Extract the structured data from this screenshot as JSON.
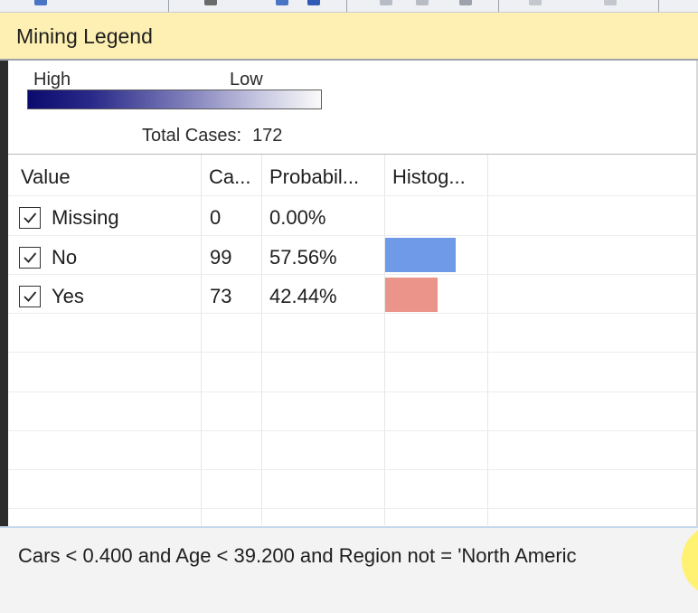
{
  "window": {
    "title": "Mining Legend"
  },
  "legend": {
    "high_label": "High",
    "low_label": "Low",
    "total_cases_label": "Total Cases:",
    "total_cases_value": "172",
    "gradient_colors": [
      "#0b0b6f",
      "#fafafa"
    ]
  },
  "table": {
    "columns": [
      "Value",
      "Ca...",
      "Probabil...",
      "Histog..."
    ],
    "rows": [
      {
        "value": "Missing",
        "checked": true,
        "cases": "0",
        "probability": "0.00%",
        "histogram_fraction": 0.0,
        "color": "#6f9ae8"
      },
      {
        "value": "No",
        "checked": true,
        "cases": "99",
        "probability": "57.56%",
        "histogram_fraction": 0.5756,
        "color": "#6f9ae8"
      },
      {
        "value": "Yes",
        "checked": true,
        "cases": "73",
        "probability": "42.44%",
        "histogram_fraction": 0.4244,
        "color": "#eb948a"
      }
    ]
  },
  "rule": {
    "text": "Cars < 0.400 and Age < 39.200 and Region not = 'North Americ"
  },
  "colors": {
    "header_bg": "#fdf0b2",
    "no_bar": "#6f9ae8",
    "yes_bar": "#eb948a"
  }
}
